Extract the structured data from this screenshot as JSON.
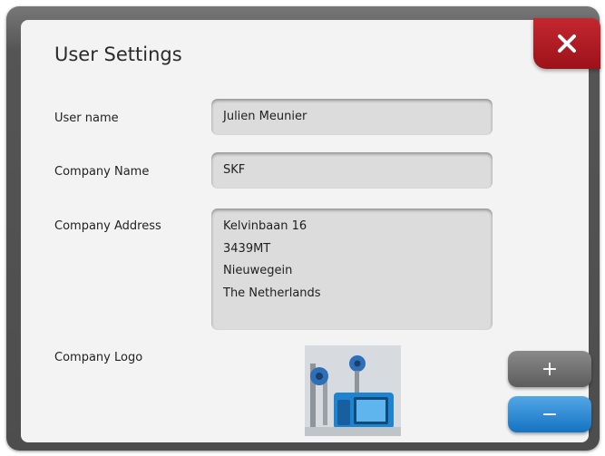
{
  "dialog": {
    "title": "User Settings",
    "close_icon": "close-x-icon",
    "accent_close": "#b01c24",
    "accent_minus": "#2a86d6"
  },
  "fields": {
    "user_name": {
      "label": "User name",
      "value": "Julien Meunier"
    },
    "company_name": {
      "label": "Company Name",
      "value": "SKF"
    },
    "company_address": {
      "label": "Company Address",
      "lines": [
        "Kelvinbaan 16",
        "3439MT",
        "Nieuwegein",
        "The Netherlands"
      ]
    },
    "company_logo": {
      "label": "Company Logo"
    }
  },
  "buttons": {
    "add_label": "+",
    "remove_label": "−"
  }
}
